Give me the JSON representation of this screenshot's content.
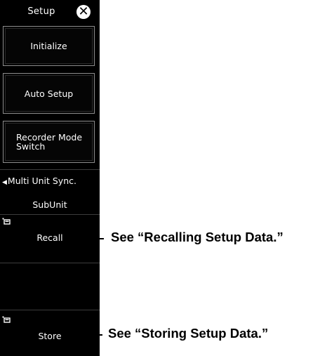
{
  "panel": {
    "title": "Setup",
    "close_icon": "close-icon",
    "buttons": {
      "initialize": "Initialize",
      "auto_setup": "Auto Setup",
      "recorder_mode_switch": "Recorder Mode\nSwitch"
    },
    "multi_unit_sync": {
      "label": "Multi Unit Sync.",
      "value": "SubUnit"
    },
    "recall": {
      "label": "Recall",
      "icon": "folder-icon"
    },
    "store": {
      "label": "Store",
      "icon": "folder-icon"
    }
  },
  "annotations": {
    "recall": "See “Recalling Setup Data.”",
    "store": "See “Storing Setup Data.”"
  }
}
